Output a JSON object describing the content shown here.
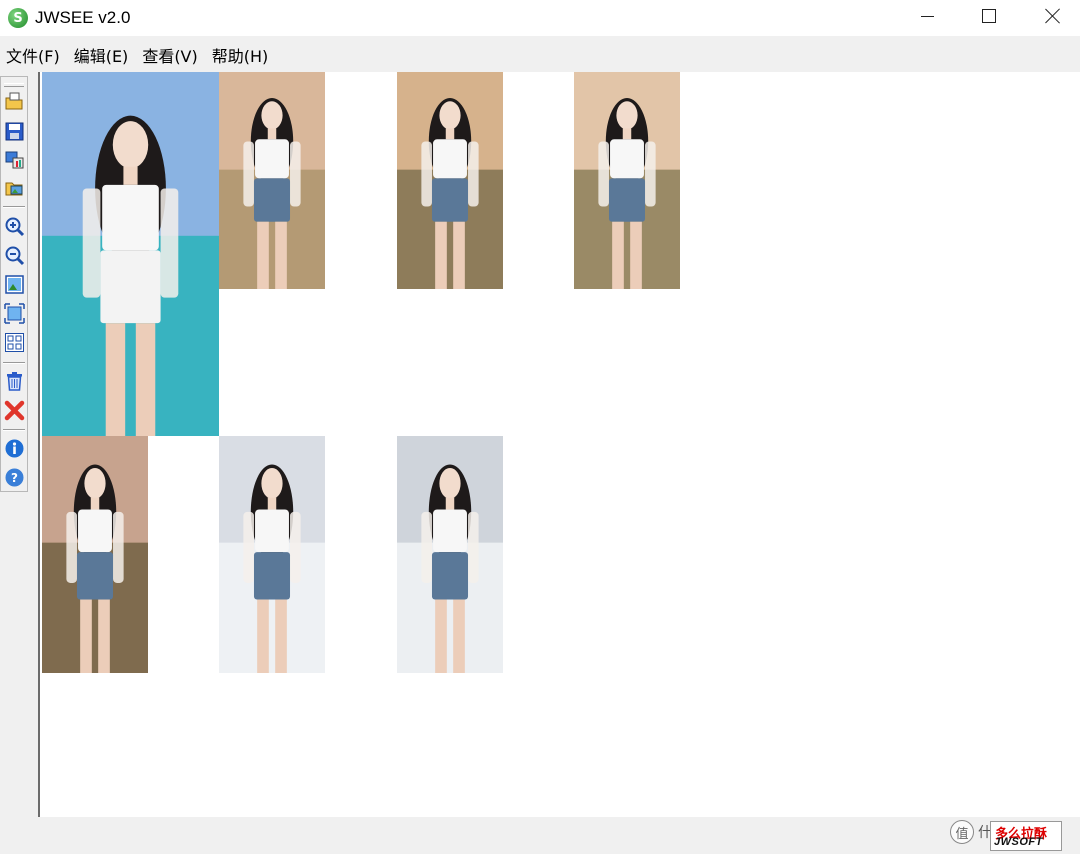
{
  "window": {
    "title": "JWSEE v2.0",
    "app_icon_glyph": "S",
    "controls": [
      "minimize-icon",
      "maximize-icon",
      "close-icon"
    ]
  },
  "menu": {
    "items": [
      {
        "label": "文件(F)"
      },
      {
        "label": "编辑(E)"
      },
      {
        "label": "查看(V)"
      },
      {
        "label": "帮助(H)"
      }
    ]
  },
  "toolbar": {
    "buttons": [
      {
        "icon": "open-folder-icon"
      },
      {
        "icon": "save-icon"
      },
      {
        "icon": "convert-icon"
      },
      {
        "icon": "export-image-icon"
      },
      {
        "icon": "zoom-in-icon"
      },
      {
        "icon": "zoom-out-icon"
      },
      {
        "icon": "fit-window-icon"
      },
      {
        "icon": "actual-size-icon"
      },
      {
        "icon": "thumbnail-grid-icon"
      },
      {
        "icon": "trash-icon"
      },
      {
        "icon": "delete-x-icon"
      },
      {
        "icon": "info-icon"
      },
      {
        "icon": "help-icon"
      }
    ]
  },
  "thumbnails": [
    {
      "name": "portrait-beach",
      "sky": "#8ab3e2",
      "ground": "#38b3c0"
    },
    {
      "name": "portrait-sunset-1",
      "sky": "#d9b79a",
      "ground": "#b49a74"
    },
    {
      "name": "portrait-sunset-2",
      "sky": "#d6b28c",
      "ground": "#8e7c5a"
    },
    {
      "name": "portrait-sunset-3",
      "sky": "#e2c5a8",
      "ground": "#9a8a66"
    },
    {
      "name": "portrait-sunset-birds",
      "sky": "#c7a38e",
      "ground": "#7f6b4e"
    },
    {
      "name": "portrait-snow-1",
      "sky": "#d9dde4",
      "ground": "#eef1f4"
    },
    {
      "name": "portrait-snow-2",
      "sky": "#cfd4db",
      "ground": "#eceff2"
    }
  ],
  "watermark": {
    "badge_glyph": "值",
    "text": "什么值得买"
  },
  "logo": {
    "top": "多么拉酥",
    "bottom": "JWSOFT"
  }
}
